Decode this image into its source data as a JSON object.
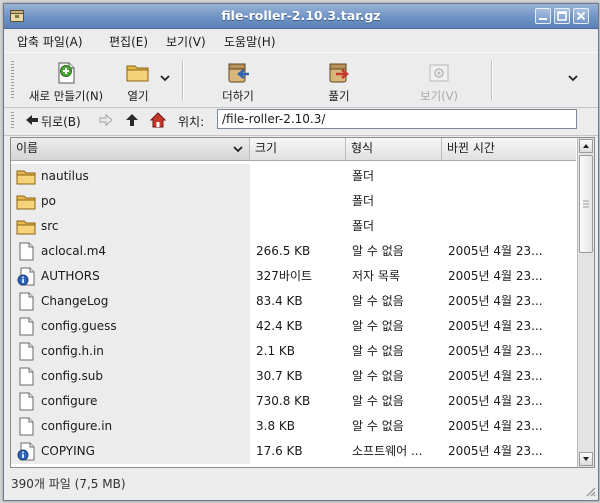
{
  "window": {
    "title": "file-roller-2.10.3.tar.gz"
  },
  "menubar": [
    {
      "label": "압축 파일(A)",
      "name": "menu-archive"
    },
    {
      "label": "편집(E)",
      "name": "menu-edit"
    },
    {
      "label": "보기(V)",
      "name": "menu-view"
    },
    {
      "label": "도움말(H)",
      "name": "menu-help"
    }
  ],
  "toolbar": {
    "new_label": "새로 만들기(N)",
    "open_label": "열기",
    "add_label": "더하기",
    "extract_label": "풀기",
    "view_label": "보기(V)"
  },
  "location": {
    "back_label": "뒤로(B)",
    "location_label": "위치:",
    "path": "/file-roller-2.10.3/"
  },
  "columns": {
    "name": "이름",
    "size": "크기",
    "type": "형식",
    "modified": "바뀐 시간"
  },
  "files": [
    {
      "name": "nautilus",
      "size": "",
      "type": "폴더",
      "date": "",
      "icon": "folder"
    },
    {
      "name": "po",
      "size": "",
      "type": "폴더",
      "date": "",
      "icon": "folder"
    },
    {
      "name": "src",
      "size": "",
      "type": "폴더",
      "date": "",
      "icon": "folder"
    },
    {
      "name": "aclocal.m4",
      "size": "266.5 KB",
      "type": "알 수 없음",
      "date": "2005년  4월 23...",
      "icon": "document"
    },
    {
      "name": "AUTHORS",
      "size": "327바이트",
      "type": "저자 목록",
      "date": "2005년  4월 23...",
      "icon": "info-document"
    },
    {
      "name": "ChangeLog",
      "size": "83.4 KB",
      "type": "알 수 없음",
      "date": "2005년  4월 23...",
      "icon": "document"
    },
    {
      "name": "config.guess",
      "size": "42.4 KB",
      "type": "알 수 없음",
      "date": "2005년  4월 23...",
      "icon": "document"
    },
    {
      "name": "config.h.in",
      "size": "2.1 KB",
      "type": "알 수 없음",
      "date": "2005년  4월 23...",
      "icon": "document"
    },
    {
      "name": "config.sub",
      "size": "30.7 KB",
      "type": "알 수 없음",
      "date": "2005년  4월 23...",
      "icon": "document"
    },
    {
      "name": "configure",
      "size": "730.8 KB",
      "type": "알 수 없음",
      "date": "2005년  4월 23...",
      "icon": "document"
    },
    {
      "name": "configure.in",
      "size": "3.8 KB",
      "type": "알 수 없음",
      "date": "2005년  4월 23...",
      "icon": "document"
    },
    {
      "name": "COPYING",
      "size": "17.6 KB",
      "type": "소프트웨어 ...",
      "date": "2005년  4월 23...",
      "icon": "info-document"
    }
  ],
  "status": {
    "text": "390개 파일 (7,5 MB)"
  }
}
